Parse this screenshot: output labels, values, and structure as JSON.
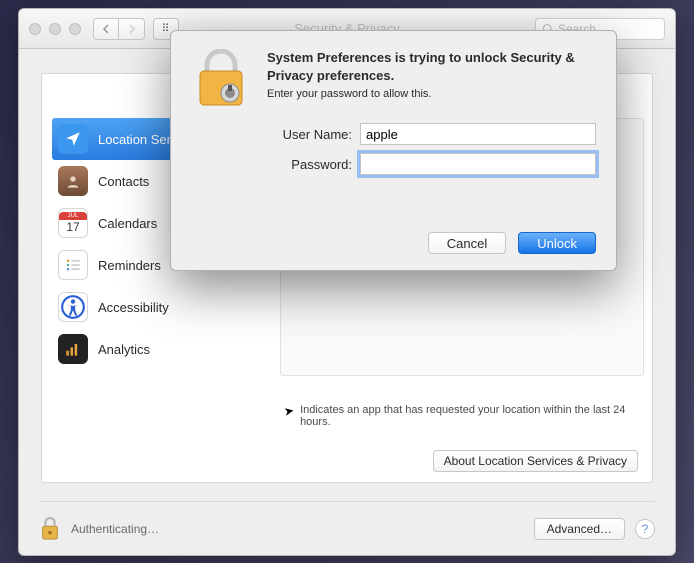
{
  "window": {
    "title": "Security & Privacy",
    "search_placeholder": "Search"
  },
  "sidebar": {
    "items": [
      {
        "label": "Location Services",
        "selected": true
      },
      {
        "label": "Contacts"
      },
      {
        "label": "Calendars"
      },
      {
        "label": "Reminders"
      },
      {
        "label": "Accessibility"
      },
      {
        "label": "Analytics"
      }
    ]
  },
  "privacy": {
    "hint": "Indicates an app that has requested your location within the last 24 hours.",
    "about_button": "About Location Services & Privacy"
  },
  "footer": {
    "status": "Authenticating…",
    "advanced": "Advanced…",
    "help": "?"
  },
  "dialog": {
    "title": "System Preferences is trying to unlock Security & Privacy preferences.",
    "subtitle": "Enter your password to allow this.",
    "username_label": "User Name:",
    "username_value": "apple",
    "password_label": "Password:",
    "password_value": "",
    "cancel": "Cancel",
    "unlock": "Unlock"
  }
}
